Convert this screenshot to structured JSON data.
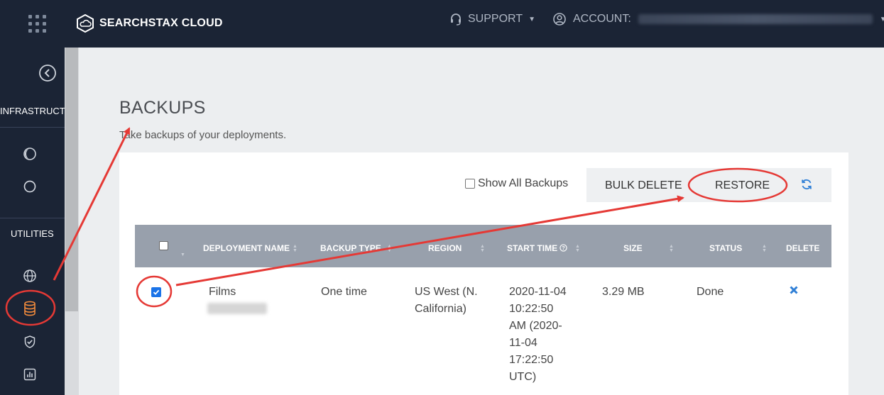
{
  "topbar": {
    "brand": "SEARCHSTAX CLOUD",
    "support_label": "SUPPORT",
    "account_label": "ACCOUNT:"
  },
  "sidebar": {
    "section_infrastructure": "INFRASTRUCTU",
    "section_utilities": "UTILITIES"
  },
  "page": {
    "title": "BACKUPS",
    "subtitle": "Take backups of your deployments."
  },
  "toolbar": {
    "show_all_label": "Show All Backups",
    "bulk_delete_label": "BULK DELETE",
    "restore_label": "RESTORE"
  },
  "table": {
    "columns": [
      "DEPLOYMENT NAME",
      "BACKUP TYPE",
      "REGION",
      "START TIME",
      "SIZE",
      "STATUS",
      "DELETE"
    ],
    "rows": [
      {
        "deployment_name": "Films",
        "backup_type": "One time",
        "region_line1": "US West (N.",
        "region_line2": "California)",
        "start_line1": "2020-11-04",
        "start_line2": "10:22:50",
        "start_line3": "AM (2020-",
        "start_line4": "11-04",
        "start_line5": "17:22:50",
        "start_line6": "UTC)",
        "size": "3.29 MB",
        "status": "Done"
      }
    ]
  },
  "colors": {
    "nav_bg": "#1b2435",
    "table_header_bg": "#98a0ac",
    "annotation_red": "#e53935",
    "accent_blue": "#2f7fd6"
  }
}
